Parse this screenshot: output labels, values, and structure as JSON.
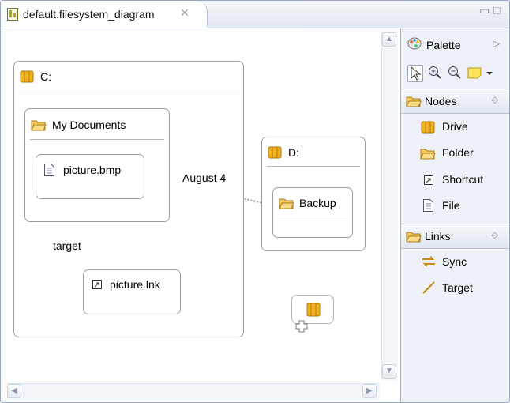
{
  "editor": {
    "tab_title": "default.filesystem_diagram",
    "close_glyph": "✕",
    "minimize_glyph": "▭",
    "maximize_glyph": "□"
  },
  "diagram": {
    "nodes": {
      "drive_c": {
        "label": "C:",
        "icon": "drive-icon"
      },
      "my_documents": {
        "label": "My Documents",
        "icon": "folder-icon"
      },
      "picture_bmp": {
        "label": "picture.bmp",
        "icon": "file-icon"
      },
      "drive_d": {
        "label": "D:",
        "icon": "drive-icon"
      },
      "backup": {
        "label": "Backup",
        "icon": "folder-icon"
      },
      "picture_lnk": {
        "label": "picture.lnk",
        "icon": "shortcut-icon"
      },
      "new_drive": {
        "label": "",
        "icon": "drive-icon"
      }
    },
    "links": {
      "sync_label": "August 4",
      "target_label": "target"
    }
  },
  "palette": {
    "title": "Palette",
    "tools": [
      "select-tool-icon",
      "zoom-in-icon",
      "zoom-out-icon",
      "note-icon"
    ],
    "drawers": [
      {
        "title": "Nodes",
        "items": [
          "Drive",
          "Folder",
          "Shortcut",
          "File"
        ]
      },
      {
        "title": "Links",
        "items": [
          "Sync",
          "Target"
        ]
      }
    ]
  },
  "colors": {
    "drive": "#f2b320",
    "folder": "#f7c95c",
    "palette_bg": "#eef2f8",
    "tab_border": "#b9c5d8"
  }
}
